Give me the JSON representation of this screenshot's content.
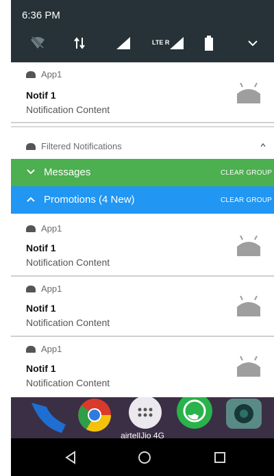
{
  "status": {
    "time": "6:36 PM",
    "network_label": "LTE R"
  },
  "notifications_top": [
    {
      "app": "App1",
      "title": "Notif 1",
      "content": "Notification Content"
    }
  ],
  "filtered": {
    "header": "Filtered Notifications"
  },
  "groups": [
    {
      "name": "Messages",
      "clear": "CLEAR GROUP",
      "color": "#4caf50",
      "expanded": false
    },
    {
      "name": "Promotions (4 New)",
      "clear": "CLEAR GROUP",
      "color": "#2196f3",
      "expanded": true
    }
  ],
  "promotions": [
    {
      "app": "App1",
      "title": "Notif 1",
      "content": "Notification Content"
    },
    {
      "app": "App1",
      "title": "Notif 1",
      "content": "Notification Content"
    },
    {
      "app": "App1",
      "title": "Notif 1",
      "content": "Notification Content"
    }
  ],
  "home": {
    "carrier": "airtel|Jio 4G"
  },
  "icons": [
    "wifi-off-icon",
    "data-arrows-icon",
    "signal-icon",
    "lte-signal-icon",
    "battery-icon",
    "expand-chevron-icon",
    "android-app-icon",
    "android-robot-icon",
    "back-icon",
    "home-icon",
    "recents-icon"
  ]
}
